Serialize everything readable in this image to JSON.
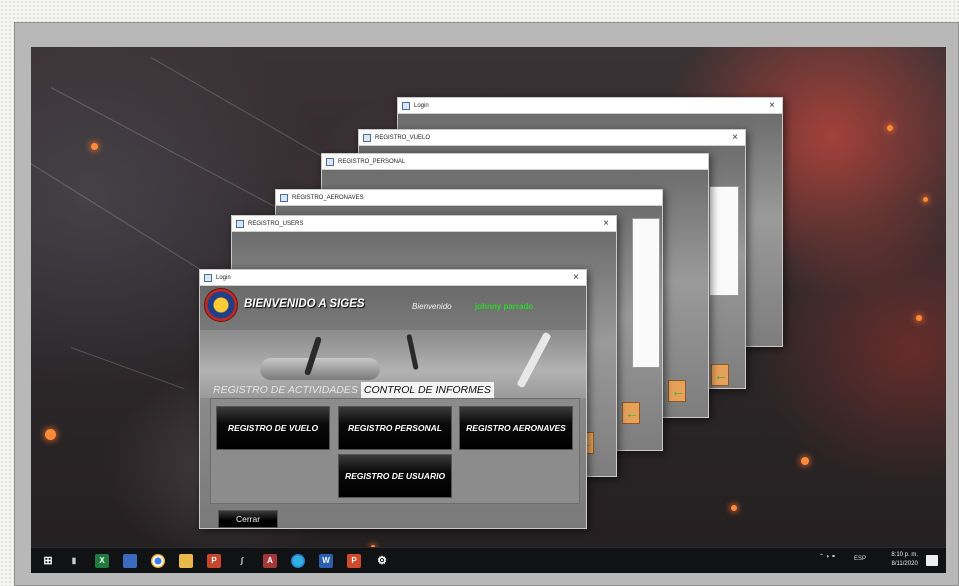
{
  "windows": [
    {
      "title": "Login",
      "close": "×"
    },
    {
      "title": "REGISTRO_VUELO",
      "close": "×"
    },
    {
      "title": "REGISTRO_PERSONAL"
    },
    {
      "title": "REGISTRO_AERONAVES"
    },
    {
      "title": "REGISTRO_USERS",
      "close": "×"
    }
  ],
  "front": {
    "title": "Login",
    "close": "×",
    "heading": "BIENVENIDO A SIGES",
    "welcome_label": "Bienvenido",
    "user_name": "johnny parrado",
    "tabs": [
      "REGISTRO DE ACTIVIDADES",
      "CONTROL DE INFORMES"
    ],
    "active_tab": 1,
    "buttons": {
      "vuelo": "REGISTRO DE VUELO",
      "personal": "REGISTRO PERSONAL",
      "aeronaves": "REGISTRO AERONAVES",
      "usuario": "REGISTRO DE USUARIO"
    },
    "close_label": "Cerrar"
  },
  "taskbar": {
    "language": "ESP",
    "time": "8:10 p. m.",
    "date": "8/11/2020"
  },
  "icons": [
    "windows-start-icon",
    "task-view-icon",
    "excel-icon",
    "calendar-app-icon",
    "chrome-icon",
    "folder-icon",
    "powerpoint-icon",
    "xampp-icon",
    "access-icon",
    "edge-icon",
    "word-icon",
    "powerpoint-2-icon",
    "settings-icon"
  ],
  "colors": {
    "user_name": "#2bd62b",
    "ember": "#ff8a3a"
  }
}
